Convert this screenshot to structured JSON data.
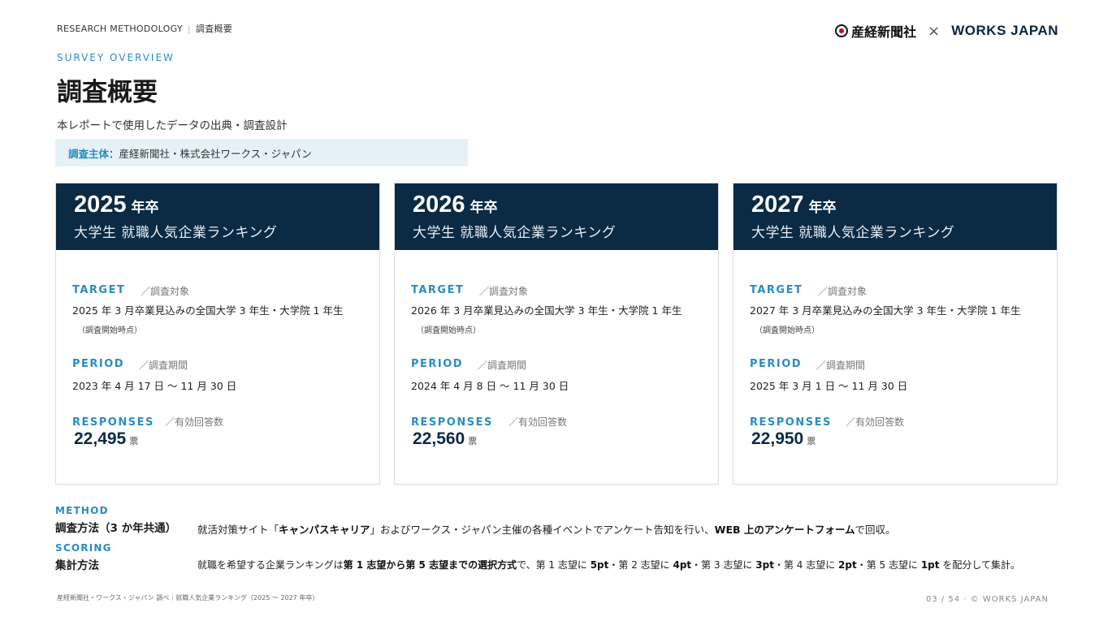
{
  "header": {
    "breadcrumb_en": "RESEARCH METHODOLOGY",
    "breadcrumb_sep": "|",
    "breadcrumb_ja": "調査概要",
    "logo_sankei": "産経新聞社",
    "logo_cross": "×",
    "logo_works": "WORKS JAPAN"
  },
  "intro": {
    "eyebrow": "SURVEY OVERVIEW",
    "title": "調査概要",
    "subtitle": "本レポートで使用したデータの出典・調査設計",
    "org_label": "調査主体",
    "org_value": "：産経新聞社・株式会社ワークス・ジャパン"
  },
  "cards": [
    {
      "year": "2025",
      "year_suffix": "年卒",
      "subtitle": "大学生 就職人気企業ランキング",
      "target_label": "TARGET",
      "target_label_ja": "／調査対象",
      "target_value": "2025 年 3 月卒業見込みの全国大学 3 年生・大学院 1 年生",
      "target_note": "（調査開始時点）",
      "period_label": "PERIOD",
      "period_label_ja": "／調査期間",
      "period_value": "2023 年 4 月 17 日 ～ 11 月 30 日",
      "responses_label": "RESPONSES",
      "responses_label_ja": "／有効回答数",
      "responses_value": "22,495",
      "responses_unit": "票"
    },
    {
      "year": "2026",
      "year_suffix": "年卒",
      "subtitle": "大学生 就職人気企業ランキング",
      "target_label": "TARGET",
      "target_label_ja": "／調査対象",
      "target_value": "2026 年 3 月卒業見込みの全国大学 3 年生・大学院 1 年生",
      "target_note": "（調査開始時点）",
      "period_label": "PERIOD",
      "period_label_ja": "／調査期間",
      "period_value": "2024 年 4 月 8 日 ～ 11 月 30 日",
      "responses_label": "RESPONSES",
      "responses_label_ja": "／有効回答数",
      "responses_value": "22,560",
      "responses_unit": "票"
    },
    {
      "year": "2027",
      "year_suffix": "年卒",
      "subtitle": "大学生 就職人気企業ランキング",
      "target_label": "TARGET",
      "target_label_ja": "／調査対象",
      "target_value": "2027 年 3 月卒業見込みの全国大学 3 年生・大学院 1 年生",
      "target_note": "（調査開始時点）",
      "period_label": "PERIOD",
      "period_label_ja": "／調査期間",
      "period_value": "2025 年 3 月 1 日 ～ 11 月 30 日",
      "responses_label": "RESPONSES",
      "responses_label_ja": "／有効回答数",
      "responses_value": "22,950",
      "responses_unit": "票"
    }
  ],
  "method": {
    "en": "METHOD",
    "ja": "調査方法（3 か年共通）",
    "desc_1": "就活対策サイト「",
    "desc_b1": "キャンパスキャリア",
    "desc_2": "」およびワークス・ジャパン主催の各種イベントでアンケート告知を行い、",
    "desc_b2": "WEB 上のアンケートフォーム",
    "desc_3": "で回収。"
  },
  "scoring": {
    "en": "SCORING",
    "ja": "集計方法",
    "desc_1": "就職を希望する企業ランキングは",
    "desc_b1": "第 1 志望から第 5 志望までの選択方式",
    "desc_2": "で、第 1 志望に ",
    "desc_b2": "5pt",
    "desc_3": "・第 2 志望に ",
    "desc_b3": "4pt",
    "desc_4": "・第 3 志望に ",
    "desc_b4": "3pt",
    "desc_5": "・第 4 志望に ",
    "desc_b5": "2pt",
    "desc_6": "・第 5 志望に ",
    "desc_b6": "1pt",
    "desc_7": " を配分して集計。"
  },
  "footer": {
    "source": "産経新聞社・ワークス・ジャパン 調べ｜就職人気企業ランキング（2025 ～ 2027 年卒）",
    "page": "03 / 54 · © WORKS JAPAN"
  }
}
